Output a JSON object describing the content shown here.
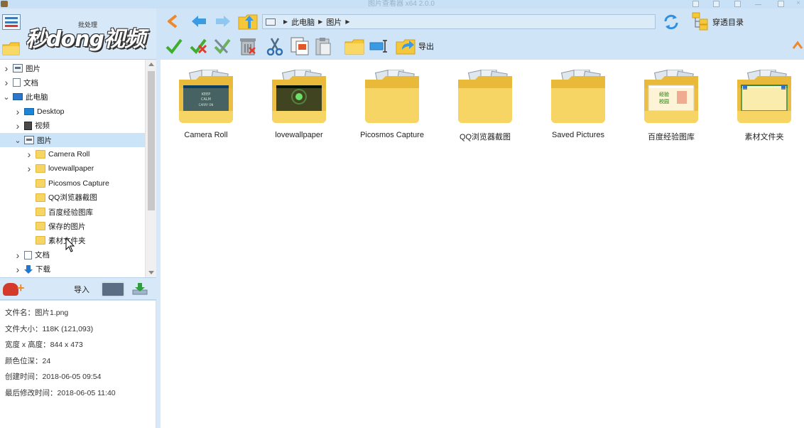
{
  "window": {
    "title": "图片查看器 x64 2.0.0"
  },
  "branding": {
    "logo_text": "秒dong视频",
    "batch_label": "批处理"
  },
  "toolbar": {
    "address": [
      "此电脑",
      "图片"
    ],
    "export_label": "导出",
    "through_dir_label": "穿透目录"
  },
  "tree": {
    "items": [
      {
        "label": "图片",
        "icon": "picture-icon",
        "expand": "collapsed",
        "level": 0
      },
      {
        "label": "文档",
        "icon": "document-icon",
        "expand": "collapsed",
        "level": 0
      },
      {
        "label": "此电脑",
        "icon": "computer-icon",
        "expand": "expanded",
        "level": 0
      },
      {
        "label": "Desktop",
        "icon": "desktop-icon",
        "expand": "collapsed",
        "level": 1
      },
      {
        "label": "视频",
        "icon": "video-icon",
        "expand": "collapsed",
        "level": 1
      },
      {
        "label": "图片",
        "icon": "picture-icon",
        "expand": "expanded",
        "level": 1,
        "selected": true
      },
      {
        "label": "Camera Roll",
        "icon": "folder-icon",
        "expand": "collapsed",
        "level": 2
      },
      {
        "label": "lovewallpaper",
        "icon": "folder-icon",
        "expand": "collapsed",
        "level": 2
      },
      {
        "label": "Picosmos Capture",
        "icon": "folder-icon",
        "expand": "none",
        "level": 2
      },
      {
        "label": "QQ浏览器截图",
        "icon": "folder-icon",
        "expand": "none",
        "level": 2
      },
      {
        "label": "百度经验图库",
        "icon": "folder-icon",
        "expand": "none",
        "level": 2
      },
      {
        "label": "保存的图片",
        "icon": "folder-icon",
        "expand": "none",
        "level": 2
      },
      {
        "label": "素材文件夹",
        "icon": "folder-icon",
        "expand": "none",
        "level": 2
      },
      {
        "label": "文档",
        "icon": "document-icon",
        "expand": "collapsed",
        "level": 1
      },
      {
        "label": "下载",
        "icon": "download-icon",
        "expand": "collapsed",
        "level": 1
      }
    ]
  },
  "import_bar": {
    "label": "导入"
  },
  "file_info": {
    "lines": [
      "文件名：图片1.png",
      "文件大小：118K (121,093)",
      "宽度 x 高度：844 x 473",
      "颜色位深：24",
      "创建时间：2018-06-05 09:54",
      "最后修改时间：2018-06-05 11:40"
    ]
  },
  "folders": [
    {
      "name": "Camera Roll",
      "preview": "keep-calm"
    },
    {
      "name": "lovewallpaper",
      "preview": "dark-green"
    },
    {
      "name": "Picosmos Capture",
      "preview": "none"
    },
    {
      "name": "QQ浏览器截图",
      "preview": "none"
    },
    {
      "name": "Saved Pictures",
      "preview": "none"
    },
    {
      "name": "百度经验图库",
      "preview": "baidu"
    },
    {
      "name": "素材文件夹",
      "preview": "paper"
    }
  ],
  "colors": {
    "chrome": "#cfe4f7",
    "folder": "#f7d565",
    "folder_dark": "#e9b93a",
    "selection": "#cce4f7"
  }
}
